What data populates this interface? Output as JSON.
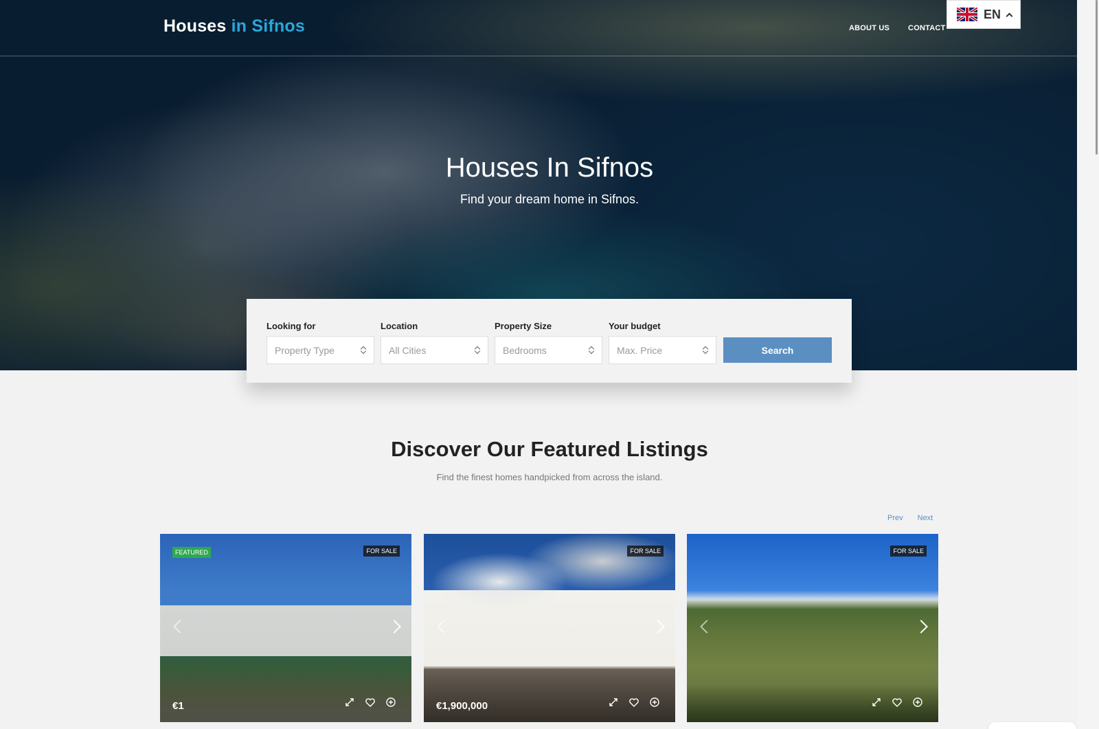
{
  "header": {
    "logo_part1": "Houses ",
    "logo_part2": "in Sifnos",
    "nav": [
      "ABOUT US",
      "CONTACT"
    ],
    "language": {
      "code": "EN",
      "flag_icon": "uk-flag-icon"
    },
    "accent_color": "#2aa7d8"
  },
  "hero": {
    "title": "Houses In Sifnos",
    "subtitle": "Find your dream home in Sifnos."
  },
  "search": {
    "fields": [
      {
        "label": "Looking for",
        "value": "Property Type"
      },
      {
        "label": "Location",
        "value": "All Cities"
      },
      {
        "label": "Property Size",
        "value": "Bedrooms"
      },
      {
        "label": "Your budget",
        "value": "Max. Price"
      }
    ],
    "button": "Search",
    "button_color": "#5b8fc2"
  },
  "featured": {
    "title": "Discover Our Featured Listings",
    "subtitle": "Find the finest homes handpicked from across the island.",
    "prev": "Prev",
    "next": "Next",
    "listings": [
      {
        "featured_badge": "FEATURED",
        "status": "FOR SALE",
        "price": "€1"
      },
      {
        "featured_badge": "",
        "status": "FOR SALE",
        "price": "€1,900,000"
      },
      {
        "featured_badge": "",
        "status": "FOR SALE",
        "price": ""
      }
    ],
    "featured_badge_color": "#2eaa4e"
  }
}
